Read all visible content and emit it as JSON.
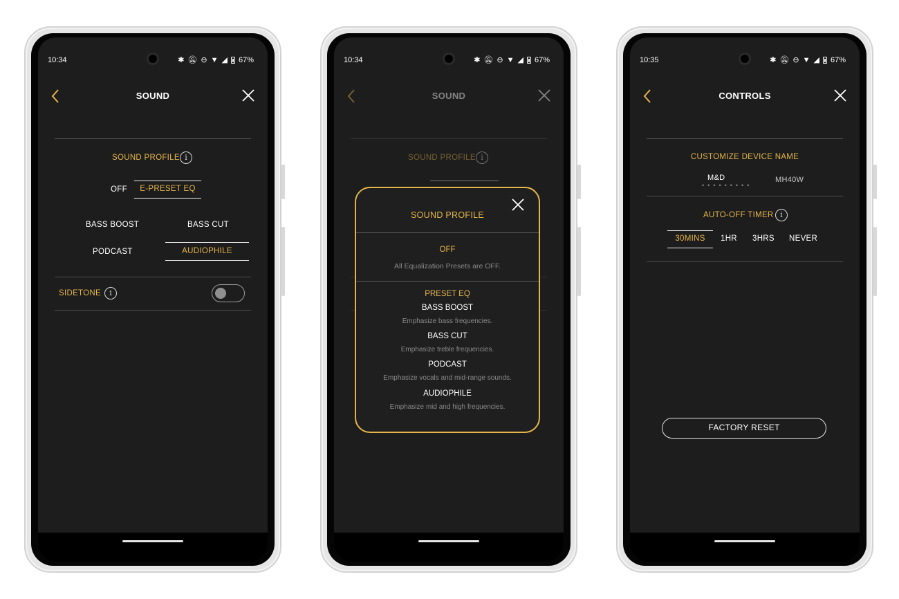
{
  "status_bars": [
    {
      "time": "10:34",
      "battery": "67%"
    },
    {
      "time": "10:34",
      "battery": "67%"
    },
    {
      "time": "10:35",
      "battery": "67%"
    }
  ],
  "sound_screen": {
    "title": "SOUND",
    "sound_profile_label": "SOUND PROFILE",
    "off_label": "OFF",
    "preset_label": "E-PRESET EQ",
    "bass_boost": "BASS BOOST",
    "bass_cut": "BASS CUT",
    "podcast": "PODCAST",
    "audiophile": "AUDIOPHILE",
    "sidetone_label": "SIDETONE",
    "sidetone_on": false
  },
  "sound_modal": {
    "bg_title": "SOUND",
    "bg_sound_profile": "SOUND PROFILE",
    "title": "SOUND PROFILE",
    "off_title": "OFF",
    "off_desc": "All Equalization Presets are OFF.",
    "preset_title": "PRESET EQ",
    "items": [
      {
        "name": "BASS BOOST",
        "desc": "Emphasize bass frequencies."
      },
      {
        "name": "BASS CUT",
        "desc": "Emphasize treble frequencies."
      },
      {
        "name": "PODCAST",
        "desc": "Emphasize vocals and mid-range sounds."
      },
      {
        "name": "AUDIOPHILE",
        "desc": "Emphasize mid and high frequencies."
      }
    ]
  },
  "controls_screen": {
    "title": "CONTROLS",
    "device_name_label": "CUSTOMIZE DEVICE NAME",
    "device_prefix": "M&D",
    "device_name": "MH40W",
    "auto_off_label": "AUTO-OFF TIMER",
    "timer_options": [
      "30MINS",
      "1HR",
      "3HRS",
      "NEVER"
    ],
    "selected_timer": "30MINS",
    "factory_reset": "FACTORY RESET"
  },
  "colors": {
    "accent": "#e5b54a",
    "screen_bg": "#1d1d1d"
  }
}
